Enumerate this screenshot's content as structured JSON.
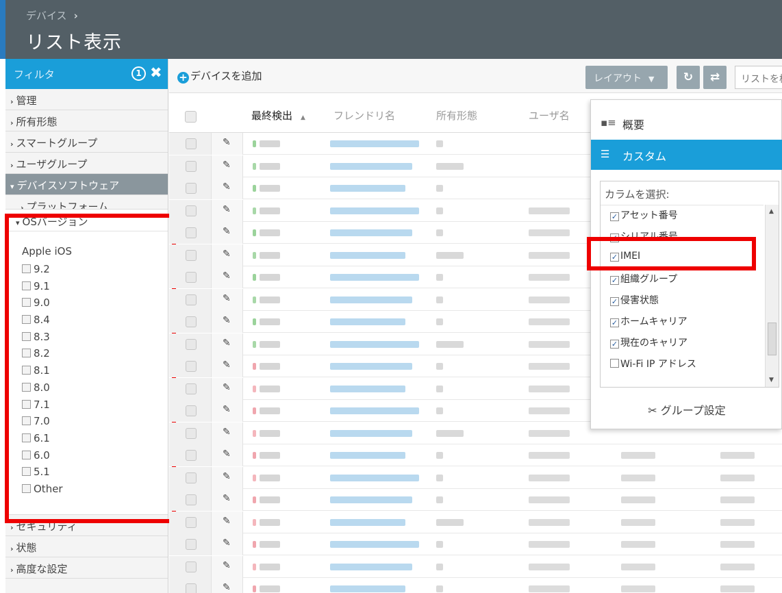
{
  "header": {
    "breadcrumb": "デバイス",
    "breadcrumb_chevron": "›",
    "title": "リスト表示"
  },
  "sidebar": {
    "filter_label": "フィルタ",
    "filter_count": "1",
    "close_glyph": "✖",
    "items_top": [
      {
        "label": "管理"
      },
      {
        "label": "所有形態"
      },
      {
        "label": "スマートグループ"
      },
      {
        "label": "ユーザグループ"
      }
    ],
    "active_item": "デバイスソフトウェア",
    "sub_item": "プラットフォーム",
    "os_panel": {
      "title": "OSバージョン",
      "platform": "Apple iOS",
      "options": [
        "9.2",
        "9.1",
        "9.0",
        "8.4",
        "8.3",
        "8.2",
        "8.1",
        "8.0",
        "7.1",
        "7.0",
        "6.1",
        "6.0",
        "5.1",
        "Other"
      ]
    },
    "items_bottom": [
      {
        "label": "セキュリティ"
      },
      {
        "label": "状態"
      },
      {
        "label": "高度な設定"
      }
    ]
  },
  "toolbar": {
    "add_label": "デバイスを追加",
    "layout_label": "レイアウト",
    "refresh_glyph": "↻",
    "export_glyph": "⇄",
    "search_placeholder": "リストを検"
  },
  "table": {
    "columns": [
      "最終検出",
      "フレンドリ名",
      "所有形態",
      "ユーザ名"
    ],
    "sort_glyph": "▲",
    "edit_glyph": "✎",
    "row_count": 21
  },
  "dropdown": {
    "overview": "概要",
    "custom": "カスタム",
    "column_select_label": "カラムを選択:",
    "columns": [
      {
        "label": "アセット番号",
        "checked": true
      },
      {
        "label": "シリアル番号",
        "checked": true
      },
      {
        "label": "IMEI",
        "checked": true
      },
      {
        "label": "組織グループ",
        "checked": true
      },
      {
        "label": "侵害状態",
        "checked": true
      },
      {
        "label": "ホームキャリア",
        "checked": true
      },
      {
        "label": "現在のキャリア",
        "checked": true
      },
      {
        "label": "Wi-Fi IP アドレス",
        "checked": false
      }
    ],
    "group_settings": "グループ設定"
  },
  "colors": {
    "header_bg": "#535f66",
    "accent_blue": "#1a9ed9",
    "highlight_red": "#ee0000",
    "layout_btn": "#97a6ae"
  }
}
